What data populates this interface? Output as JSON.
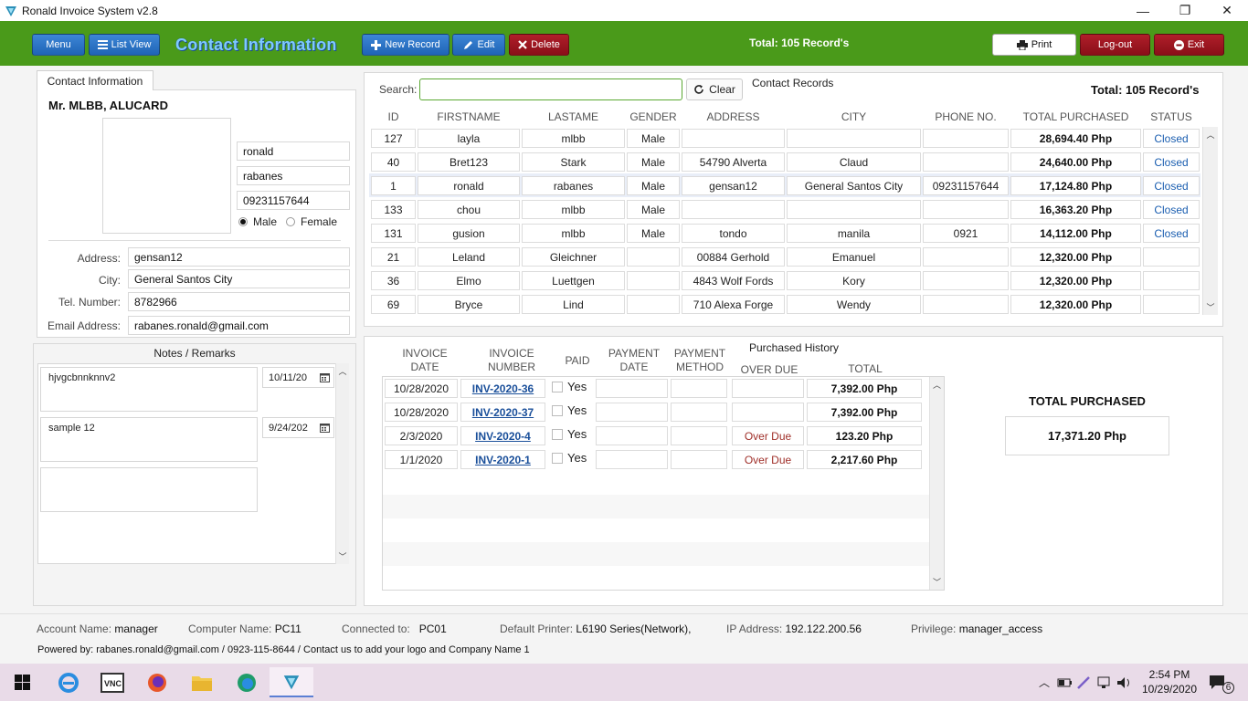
{
  "window": {
    "title": "Ronald Invoice System v2.8",
    "controls": {
      "minimize": "—",
      "restore": "❐",
      "close": "✕"
    }
  },
  "toolbar": {
    "menu_label": "Menu",
    "list_view_label": "List View",
    "page_title": "Contact Information",
    "new_record_label": "New Record",
    "edit_label": "Edit",
    "delete_label": "Delete",
    "total_records": "Total: 105 Record's",
    "print_label": "Print",
    "logout_label": "Log-out",
    "exit_label": "Exit"
  },
  "contact": {
    "tab_label": "Contact Information",
    "display_name": "Mr. MLBB, ALUCARD",
    "first_name": "ronald",
    "last_name": "rabanes",
    "phone": "09231157644",
    "gender_male_label": "Male",
    "gender_female_label": "Female",
    "gender_selected": "Male",
    "address_label": "Address:",
    "address": "gensan12",
    "city_label": "City:",
    "city": "General Santos City",
    "tel_label": "Tel. Number:",
    "tel": "8782966",
    "email_label": "Email Address:",
    "email": "rabanes.ronald@gmail.com"
  },
  "notes": {
    "title": "Notes / Remarks",
    "items": [
      {
        "text": "hjvgcbnnknnv2",
        "date": "10/11/20"
      },
      {
        "text": "sample 12",
        "date": "9/24/202"
      },
      {
        "text": "",
        "date": ""
      }
    ]
  },
  "records": {
    "search_label": "Search:",
    "search_value": "",
    "clear_label": "Clear",
    "title": "Contact Records",
    "total": "Total: 105 Record's",
    "columns": [
      "ID",
      "FIRSTNAME",
      "LASTAME",
      "GENDER",
      "ADDRESS",
      "CITY",
      "PHONE NO.",
      "TOTAL PURCHASED",
      "STATUS"
    ],
    "rows": [
      {
        "id": "127",
        "first": "layla",
        "last": "mlbb",
        "gender": "Male",
        "address": "",
        "city": "",
        "phone": "",
        "total": "28,694.40 Php",
        "status": "Closed"
      },
      {
        "id": "40",
        "first": "Bret123",
        "last": "Stark",
        "gender": "Male",
        "address": "54790 Alverta",
        "city": "Claud",
        "phone": "",
        "total": "24,640.00 Php",
        "status": "Closed"
      },
      {
        "id": "1",
        "first": "ronald",
        "last": "rabanes",
        "gender": "Male",
        "address": "gensan12",
        "city": "General Santos City",
        "phone": "09231157644",
        "total": "17,124.80 Php",
        "status": "Closed"
      },
      {
        "id": "133",
        "first": "chou",
        "last": "mlbb",
        "gender": "Male",
        "address": "",
        "city": "",
        "phone": "",
        "total": "16,363.20 Php",
        "status": "Closed"
      },
      {
        "id": "131",
        "first": "gusion",
        "last": "mlbb",
        "gender": "Male",
        "address": "tondo",
        "city": "manila",
        "phone": "0921",
        "total": "14,112.00 Php",
        "status": "Closed"
      },
      {
        "id": "21",
        "first": "Leland",
        "last": "Gleichner",
        "gender": "",
        "address": "00884 Gerhold",
        "city": "Emanuel",
        "phone": "",
        "total": "12,320.00 Php",
        "status": ""
      },
      {
        "id": "36",
        "first": "Elmo",
        "last": "Luettgen",
        "gender": "",
        "address": "4843 Wolf Fords",
        "city": "Kory",
        "phone": "",
        "total": "12,320.00 Php",
        "status": ""
      },
      {
        "id": "69",
        "first": "Bryce",
        "last": "Lind",
        "gender": "",
        "address": "710 Alexa Forge",
        "city": "Wendy",
        "phone": "",
        "total": "12,320.00 Php",
        "status": ""
      }
    ]
  },
  "history": {
    "title": "Purchased History",
    "col_invoice_date": [
      "INVOICE",
      "DATE"
    ],
    "col_invoice_number": [
      "INVOICE",
      "NUMBER"
    ],
    "col_paid": "PAID",
    "col_payment_date": [
      "PAYMENT",
      "DATE"
    ],
    "col_payment_method": [
      "PAYMENT",
      "METHOD"
    ],
    "col_overdue": "OVER DUE",
    "col_total": "TOTAL",
    "rows": [
      {
        "date": "10/28/2020",
        "number": "INV-2020-36",
        "paid": "Yes",
        "payment_date": "",
        "payment_method": "",
        "overdue": "",
        "total": "7,392.00 Php"
      },
      {
        "date": "10/28/2020",
        "number": "INV-2020-37",
        "paid": "Yes",
        "payment_date": "",
        "payment_method": "",
        "overdue": "",
        "total": "7,392.00 Php"
      },
      {
        "date": "2/3/2020",
        "number": "INV-2020-4",
        "paid": "Yes",
        "payment_date": "",
        "payment_method": "",
        "overdue": "Over Due",
        "total": "123.20 Php"
      },
      {
        "date": "1/1/2020",
        "number": "INV-2020-1",
        "paid": "Yes",
        "payment_date": "",
        "payment_method": "",
        "overdue": "Over Due",
        "total": "2,217.60 Php"
      }
    ],
    "total_purchased_label": "TOTAL PURCHASED",
    "total_purchased_value": "17,371.20 Php"
  },
  "status": {
    "account_label": "Account Name:",
    "account": "manager",
    "computer_label": "Computer Name:",
    "computer": "PC11",
    "connected_label": "Connected to:",
    "connected": "PC01",
    "printer_label": "Default Printer:",
    "printer": "L6190 Series(Network),",
    "ip_label": "IP Address:",
    "ip": "192.122.200.56",
    "privilege_label": "Privilege:",
    "privilege": "manager_access",
    "powered_by": "Powered by: rabanes.ronald@gmail.com / 0923-115-8644  /  Contact us to add your logo and Company Name 1"
  },
  "taskbar": {
    "time": "2:54 PM",
    "date": "10/29/2020",
    "notification_count": "6"
  },
  "colors": {
    "toolbar_green": "#4a9a1a",
    "button_blue": "#1f64b6",
    "button_red": "#8a0f18",
    "status_link": "#1a5eb0",
    "overdue_red": "#a0302a"
  }
}
